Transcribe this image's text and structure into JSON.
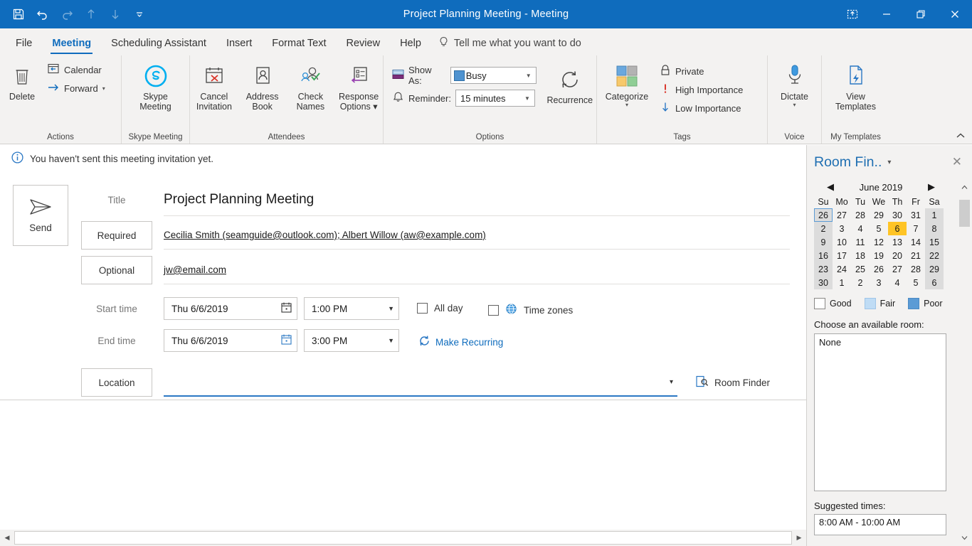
{
  "titlebar": {
    "document_title": "Project Planning Meeting",
    "separator": "-",
    "type_label": "Meeting",
    "qat": [
      {
        "name": "save-icon",
        "label": "Save"
      },
      {
        "name": "undo-icon",
        "label": "Undo"
      },
      {
        "name": "redo-icon",
        "label": "Redo"
      },
      {
        "name": "previous-item-icon",
        "label": "Previous Item"
      },
      {
        "name": "next-item-icon",
        "label": "Next Item"
      },
      {
        "name": "customize-quick-access-toolbar-icon",
        "label": "Customize Quick Access Toolbar"
      }
    ],
    "window_controls": [
      {
        "name": "ribbon-display-options-icon",
        "label": "Ribbon Display Options"
      },
      {
        "name": "minimize-icon",
        "label": "Minimize"
      },
      {
        "name": "restore-icon",
        "label": "Restore Down"
      },
      {
        "name": "close-icon",
        "label": "Close"
      }
    ]
  },
  "tabs": [
    {
      "label": "File",
      "active": false
    },
    {
      "label": "Meeting",
      "active": true
    },
    {
      "label": "Scheduling Assistant",
      "active": false
    },
    {
      "label": "Insert",
      "active": false
    },
    {
      "label": "Format Text",
      "active": false
    },
    {
      "label": "Review",
      "active": false
    },
    {
      "label": "Help",
      "active": false
    }
  ],
  "tell_me": {
    "icon": "lightbulb-icon",
    "placeholder": "Tell me what you want to do"
  },
  "ribbon": {
    "collapse_label": "^",
    "groups": {
      "actions": {
        "label": "Actions",
        "delete_label": "Delete",
        "calendar_label": "Calendar",
        "forward_label": "Forward",
        "forward_chevron": "▾"
      },
      "skype": {
        "label": "Skype Meeting",
        "button_line1": "Skype",
        "button_line2": "Meeting"
      },
      "attendees": {
        "label": "Attendees",
        "cancel_line1": "Cancel",
        "cancel_line2": "Invitation",
        "address_line1": "Address",
        "address_line2": "Book",
        "check_line1": "Check",
        "check_line2": "Names",
        "response_line1": "Response",
        "response_line2": "Options ▾"
      },
      "options": {
        "label": "Options",
        "show_as_label": "Show As:",
        "show_as_value": "Busy",
        "reminder_label": "Reminder:",
        "reminder_value": "15 minutes",
        "recurrence_label": "Recurrence"
      },
      "tags": {
        "label": "Tags",
        "categorize_label": "Categorize",
        "categorize_chevron": "▾",
        "private_label": "Private",
        "high_importance_label": "High Importance",
        "low_importance_label": "Low Importance"
      },
      "voice": {
        "label": "Voice",
        "dictate_label": "Dictate",
        "dictate_chevron": "▾"
      },
      "my_templates": {
        "label": "My Templates",
        "view_line1": "View",
        "view_line2": "Templates"
      }
    }
  },
  "infobar": {
    "icon": "info-icon",
    "text": "You haven't sent this meeting invitation yet."
  },
  "form": {
    "send_label": "Send",
    "title_label": "Title",
    "title_value": "Project Planning Meeting",
    "required_label": "Required",
    "required_value": "Cecilia Smith (seamguide@outlook.com); Albert Willow (aw@example.com)",
    "optional_label": "Optional",
    "optional_value": "jw@email.com",
    "start_time_label": "Start time",
    "start_date_value": "Thu 6/6/2019",
    "start_clock_value": "1:00 PM",
    "end_time_label": "End time",
    "end_date_value": "Thu 6/6/2019",
    "end_clock_value": "3:00 PM",
    "all_day_label": "All day",
    "time_zones_label": "Time zones",
    "make_recurring_label": "Make Recurring",
    "location_label": "Location",
    "location_value": "",
    "location_dropdown": "▾",
    "room_finder_label": "Room Finder"
  },
  "room_finder": {
    "title": "Room Fin..",
    "chevron": "▾",
    "close": "✕",
    "calendar": {
      "prev": "◀",
      "next": "▶",
      "month_year": "June 2019",
      "weekdays": [
        "Su",
        "Mo",
        "Tu",
        "We",
        "Th",
        "Fr",
        "Sa"
      ],
      "weeks": [
        [
          {
            "d": "26",
            "out": true,
            "wk": true,
            "sel": true
          },
          {
            "d": "27",
            "out": true
          },
          {
            "d": "28",
            "out": true
          },
          {
            "d": "29",
            "out": true
          },
          {
            "d": "30",
            "out": true
          },
          {
            "d": "31",
            "out": true
          },
          {
            "d": "1",
            "wk": true
          }
        ],
        [
          {
            "d": "2",
            "wk": true
          },
          {
            "d": "3"
          },
          {
            "d": "4"
          },
          {
            "d": "5"
          },
          {
            "d": "6",
            "today": true
          },
          {
            "d": "7"
          },
          {
            "d": "8",
            "wk": true
          }
        ],
        [
          {
            "d": "9",
            "wk": true
          },
          {
            "d": "10"
          },
          {
            "d": "11"
          },
          {
            "d": "12"
          },
          {
            "d": "13"
          },
          {
            "d": "14"
          },
          {
            "d": "15",
            "wk": true
          }
        ],
        [
          {
            "d": "16",
            "wk": true
          },
          {
            "d": "17"
          },
          {
            "d": "18"
          },
          {
            "d": "19"
          },
          {
            "d": "20"
          },
          {
            "d": "21"
          },
          {
            "d": "22",
            "wk": true
          }
        ],
        [
          {
            "d": "23",
            "wk": true
          },
          {
            "d": "24"
          },
          {
            "d": "25"
          },
          {
            "d": "26"
          },
          {
            "d": "27"
          },
          {
            "d": "28"
          },
          {
            "d": "29",
            "wk": true
          }
        ],
        [
          {
            "d": "30",
            "wk": true
          },
          {
            "d": "1",
            "out": true
          },
          {
            "d": "2",
            "out": true
          },
          {
            "d": "3",
            "out": true
          },
          {
            "d": "4",
            "out": true
          },
          {
            "d": "5",
            "out": true
          },
          {
            "d": "6",
            "out": true,
            "wk": true
          }
        ]
      ]
    },
    "legend": [
      {
        "label": "Good",
        "color": "#ffffff"
      },
      {
        "label": "Fair",
        "color": "#bfdcf5"
      },
      {
        "label": "Poor",
        "color": "#5b9bd5"
      }
    ],
    "choose_room_label": "Choose an available room:",
    "room_list_value": "None",
    "suggested_times_label": "Suggested times:",
    "suggested_times_value": "8:00 AM - 10:00 AM"
  },
  "scrollbars": {
    "h_left_arrow": "◀",
    "h_right_arrow": "▶",
    "v_up_arrow": "⌃",
    "v_down_arrow": "⌄"
  },
  "colors": {
    "titlebar": "#0f6cbd",
    "accent": "#0f6cbd",
    "ribbon_bg": "#f3f2f1",
    "today_highlight": "#ffc425",
    "link": "#1f6fb2"
  }
}
